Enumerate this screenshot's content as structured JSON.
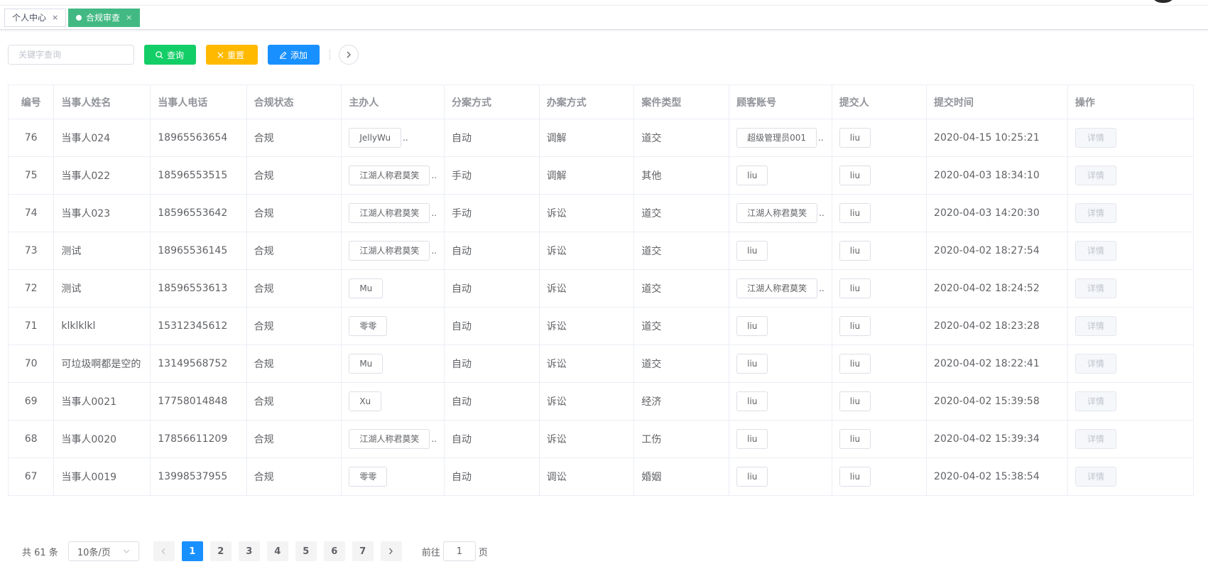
{
  "tabs": [
    {
      "label": "个人中心",
      "active": false
    },
    {
      "label": "合规审查",
      "active": true
    }
  ],
  "toolbar": {
    "search_placeholder": "关键字查询",
    "query_label": "查询",
    "reset_label": "重置",
    "add_label": "添加"
  },
  "table": {
    "headers": [
      "编号",
      "当事人姓名",
      "当事人电话",
      "合规状态",
      "主办人",
      "分案方式",
      "办案方式",
      "案件类型",
      "顾客账号",
      "提交人",
      "提交时间",
      "操作"
    ],
    "rows": [
      {
        "id": "76",
        "name": "当事人024",
        "phone": "18965563654",
        "status": "合规",
        "host": "JellyWu",
        "assign": "自动",
        "handle": "调解",
        "type": "道交",
        "account": "超级管理员001",
        "submitter": "liu",
        "time": "2020-04-15 10:25:21",
        "action": "详情"
      },
      {
        "id": "75",
        "name": "当事人022",
        "phone": "18596553515",
        "status": "合规",
        "host": "江湖人称君莫笑",
        "assign": "手动",
        "handle": "调解",
        "type": "其他",
        "account": "liu",
        "submitter": "liu",
        "time": "2020-04-03 18:34:10",
        "action": "详情"
      },
      {
        "id": "74",
        "name": "当事人023",
        "phone": "18596553642",
        "status": "合规",
        "host": "江湖人称君莫笑",
        "assign": "手动",
        "handle": "诉讼",
        "type": "道交",
        "account": "江湖人称君莫笑",
        "submitter": "liu",
        "time": "2020-04-03 14:20:30",
        "action": "详情"
      },
      {
        "id": "73",
        "name": "测试",
        "phone": "18965536145",
        "status": "合规",
        "host": "江湖人称君莫笑",
        "assign": "自动",
        "handle": "诉讼",
        "type": "道交",
        "account": "liu",
        "submitter": "liu",
        "time": "2020-04-02 18:27:54",
        "action": "详情"
      },
      {
        "id": "72",
        "name": "测试",
        "phone": "18596553613",
        "status": "合规",
        "host": "Mu",
        "assign": "自动",
        "handle": "诉讼",
        "type": "道交",
        "account": "江湖人称君莫笑",
        "submitter": "liu",
        "time": "2020-04-02 18:24:52",
        "action": "详情"
      },
      {
        "id": "71",
        "name": "klklklkl",
        "phone": "15312345612",
        "status": "合规",
        "host": "零零",
        "assign": "自动",
        "handle": "诉讼",
        "type": "道交",
        "account": "liu",
        "submitter": "liu",
        "time": "2020-04-02 18:23:28",
        "action": "详情"
      },
      {
        "id": "70",
        "name": "可垃圾啊都是空的",
        "phone": "13149568752",
        "status": "合规",
        "host": "Mu",
        "assign": "自动",
        "handle": "诉讼",
        "type": "道交",
        "account": "liu",
        "submitter": "liu",
        "time": "2020-04-02 18:22:41",
        "action": "详情"
      },
      {
        "id": "69",
        "name": "当事人0021",
        "phone": "17758014848",
        "status": "合规",
        "host": "Xu",
        "assign": "自动",
        "handle": "诉讼",
        "type": "经济",
        "account": "liu",
        "submitter": "liu",
        "time": "2020-04-02 15:39:58",
        "action": "详情"
      },
      {
        "id": "68",
        "name": "当事人0020",
        "phone": "17856611209",
        "status": "合规",
        "host": "江湖人称君莫笑",
        "assign": "自动",
        "handle": "诉讼",
        "type": "工伤",
        "account": "liu",
        "submitter": "liu",
        "time": "2020-04-02 15:39:34",
        "action": "详情"
      },
      {
        "id": "67",
        "name": "当事人0019",
        "phone": "13998537955",
        "status": "合规",
        "host": "零零",
        "assign": "自动",
        "handle": "调讼",
        "type": "婚姻",
        "account": "liu",
        "submitter": "liu",
        "time": "2020-04-02 15:38:54",
        "action": "详情"
      }
    ]
  },
  "pagination": {
    "total_text": "共 61 条",
    "page_size": "10条/页",
    "pages": [
      "1",
      "2",
      "3",
      "4",
      "5",
      "6",
      "7"
    ],
    "current_page": "1",
    "goto_label": "前往",
    "goto_value": "1",
    "page_suffix": "页"
  },
  "colors": {
    "tab_active": "#42b983",
    "query": "#13ce66",
    "reset": "#ffba00",
    "add": "#1890ff",
    "page_active": "#1890ff"
  }
}
